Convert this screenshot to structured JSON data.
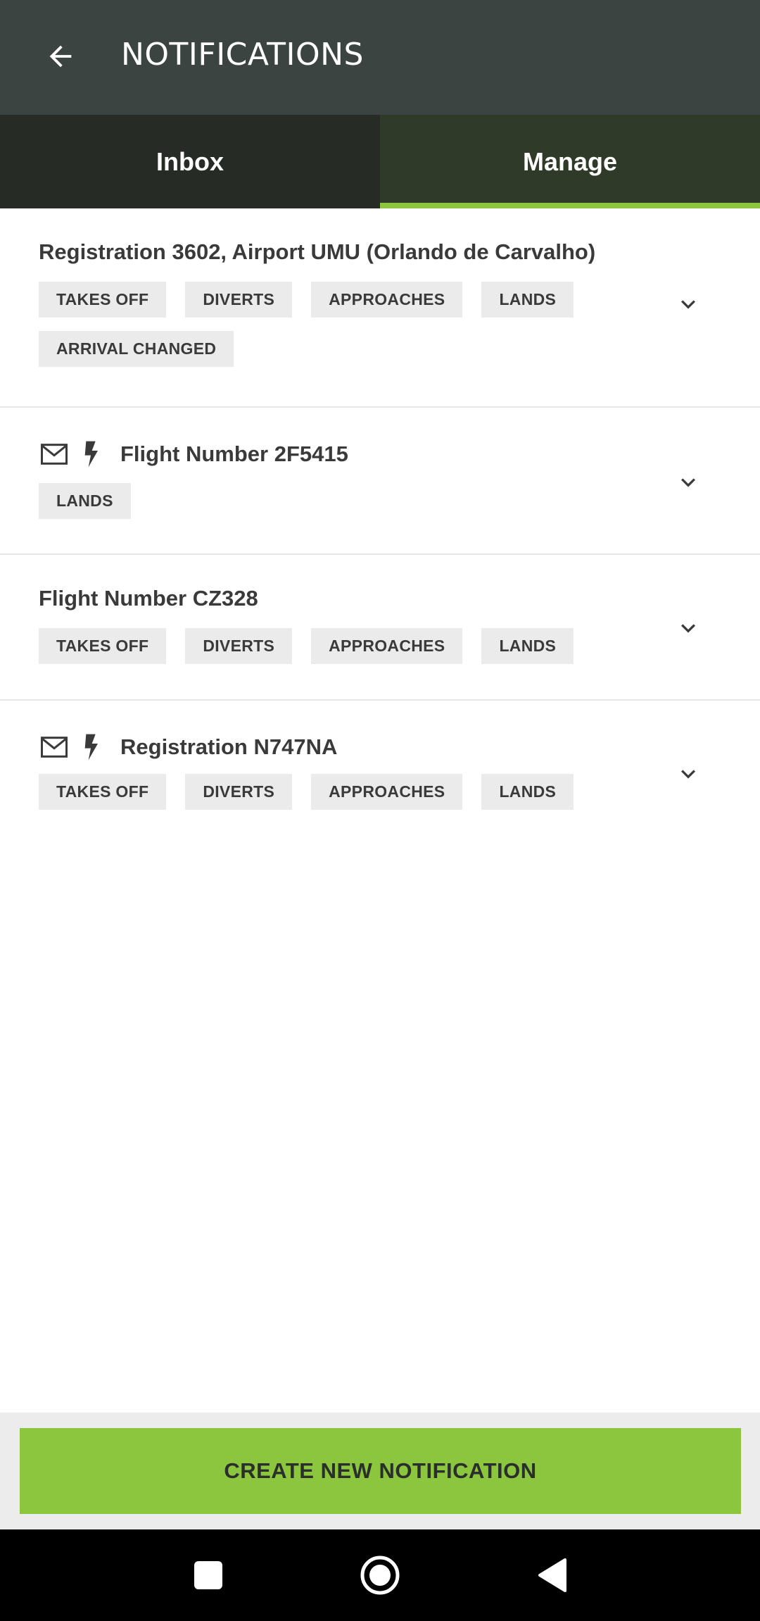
{
  "appbar": {
    "title": "NOTIFICATIONS"
  },
  "tabs": [
    {
      "label": "Inbox",
      "selected": false
    },
    {
      "label": "Manage",
      "selected": true
    }
  ],
  "items": [
    {
      "title": "Registration 3602, Airport UMU (Orlando de Carvalho)",
      "icons": [],
      "chips": [
        "TAKES OFF",
        "DIVERTS",
        "APPROACHES",
        "LANDS",
        "ARRIVAL CHANGED"
      ]
    },
    {
      "title": "Flight Number 2F5415",
      "icons": [
        "mail-icon",
        "bolt-icon"
      ],
      "chips": [
        "LANDS"
      ]
    },
    {
      "title": "Flight Number CZ328",
      "icons": [],
      "chips": [
        "TAKES OFF",
        "DIVERTS",
        "APPROACHES",
        "LANDS"
      ]
    },
    {
      "title": "Registration N747NA",
      "icons": [
        "mail-icon",
        "bolt-icon"
      ],
      "chips": [
        "TAKES OFF",
        "DIVERTS",
        "APPROACHES",
        "LANDS"
      ]
    }
  ],
  "create_button": {
    "label": "CREATE NEW NOTIFICATION"
  },
  "colors": {
    "appbar": "#3c4441",
    "tab_inbox": "#262b26",
    "tab_manage": "#2f3a28",
    "accent": "#8cc63f",
    "chip_bg": "#ebebeb",
    "text": "#3a3a3a"
  }
}
